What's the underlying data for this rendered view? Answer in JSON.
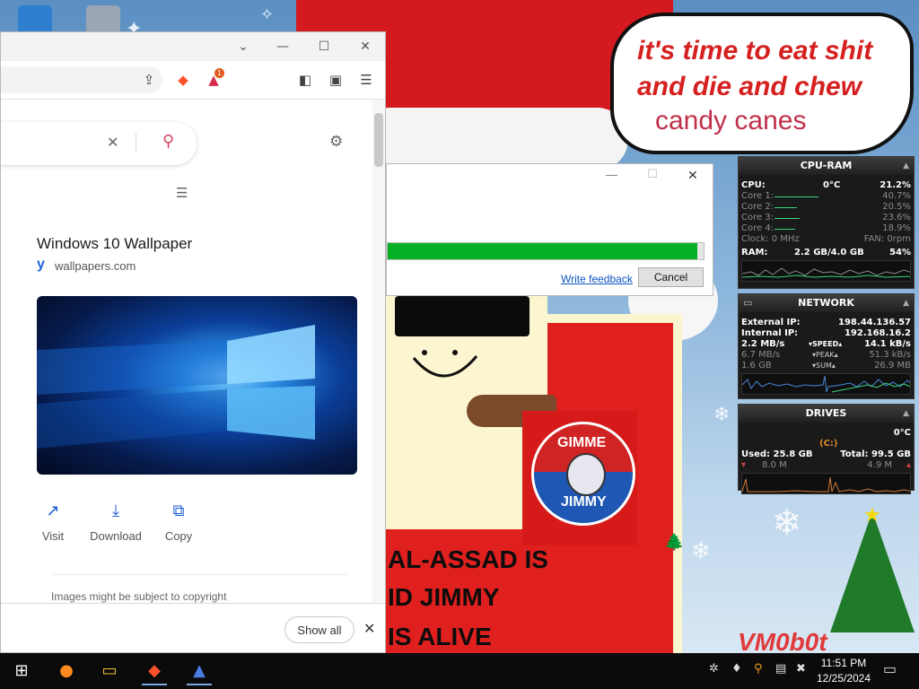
{
  "wallpaper": {
    "speech_lines": [
      "it's time to eat shit",
      "and die and chew",
      "candy canes"
    ],
    "badge_text_top": "GIMME",
    "badge_text_bottom": "JIMMY",
    "banner_lines": [
      "AL-ASSAD IS",
      "ID JIMMY",
      "IS ALIVE"
    ],
    "signature": "VM0b0t",
    "colors": {
      "hat_red": "#d4191f",
      "shirt_red": "#e0201e",
      "sky": "#5b8fc2",
      "text_red": "#d62020"
    }
  },
  "browser": {
    "result": {
      "title": "Windows 10 Wallpaper",
      "source_icon": "y",
      "source": "wallpapers.com"
    },
    "actions": [
      {
        "label": "Visit",
        "icon": "↗"
      },
      {
        "label": "Download",
        "icon": "⤓"
      },
      {
        "label": "Copy",
        "icon": "⧉"
      }
    ],
    "copyright_note": "Images might be subject to copyright",
    "download_bar": {
      "show_all": "Show all"
    },
    "brave_badge_count": "1",
    "icons": {
      "close": "✕",
      "search": "⚲",
      "gear": "⚙",
      "filter": "☰"
    }
  },
  "dialog": {
    "progress": 0.98,
    "feedback_link": "Write feedback",
    "cancel_label": "Cancel",
    "progress_color": "#06b025"
  },
  "gadgets": {
    "cpu": {
      "title": "CPU-RAM",
      "cpu_label": "CPU:",
      "cpu_temp": "0°C",
      "cpu_pct": "21.2%",
      "cores": [
        {
          "label": "Core 1:",
          "value": "40.7%",
          "level": 0.407
        },
        {
          "label": "Core 2:",
          "value": "20.5%",
          "level": 0.205
        },
        {
          "label": "Core 3:",
          "value": "23.6%",
          "level": 0.236
        },
        {
          "label": "Core 4:",
          "value": "18.9%",
          "level": 0.189
        }
      ],
      "clock": "Clock: 0 MHz",
      "fan": "FAN: 0rpm",
      "ram_label": "RAM:",
      "ram_value": "2.2 GB/4.0 GB",
      "ram_pct": "54%"
    },
    "network": {
      "title": "NETWORK",
      "external_label": "External IP:",
      "external_ip": "198.44.136.57",
      "internal_label": "Internal IP:",
      "internal_ip": "192.168.16.2",
      "speed_down": "2.2 MB/s",
      "speed_label": "▾SPEED▴",
      "speed_up": "14.1 kB/s",
      "peak_down": "6.7 MB/s",
      "peak_label": "▾PEAK▴",
      "peak_up": "51.3 kB/s",
      "sum_down": "1.6 GB",
      "sum_label": "▾SUM▴",
      "sum_up": "26.9 MB"
    },
    "drives": {
      "title": "DRIVES",
      "temp": "0°C",
      "drive_letter": "(C:)",
      "used": "Used: 25.8 GB",
      "total": "Total: 99.5 GB",
      "read": "8.0 M",
      "write": "4.9 M"
    }
  },
  "taskbar": {
    "time": "11:51 PM",
    "date": "12/25/2024"
  }
}
